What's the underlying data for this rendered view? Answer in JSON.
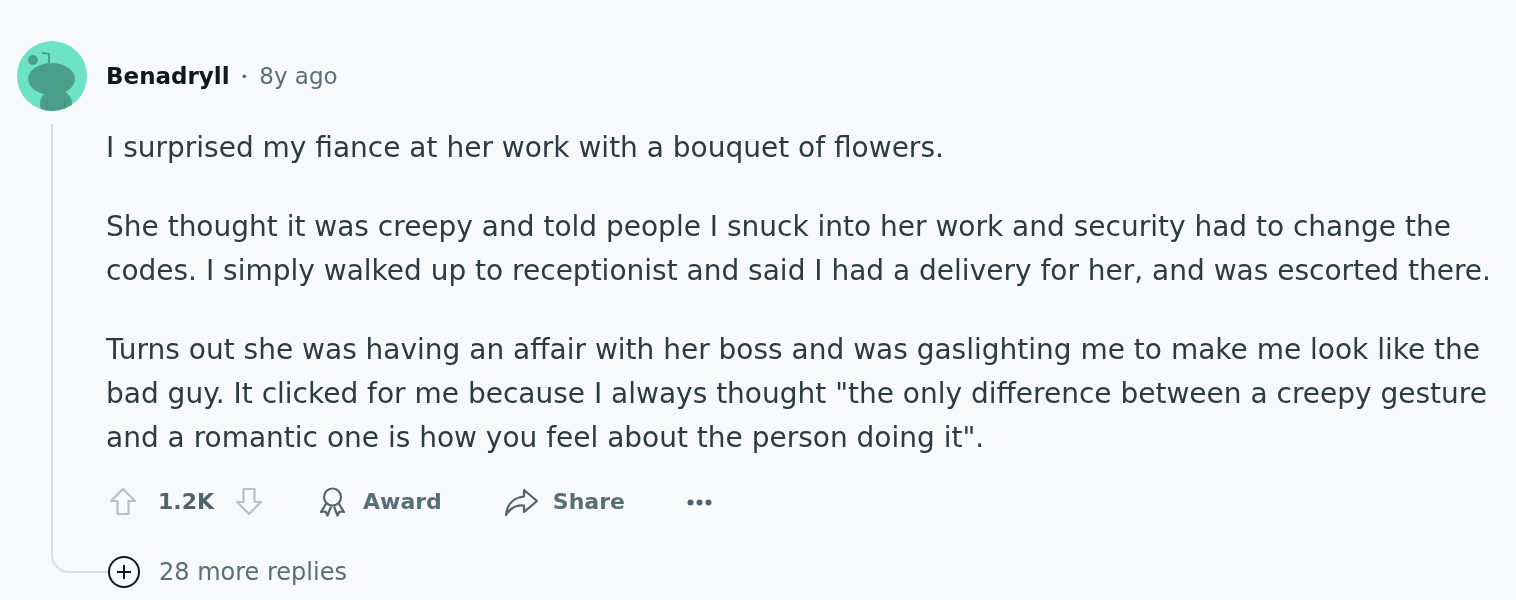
{
  "comment": {
    "author": "Benadryll",
    "separator": "•",
    "age": "8y ago",
    "paragraphs": [
      "I surprised my fiance at her work with a bouquet of flowers.",
      "She thought it was creepy and told people I snuck into her work and security had to change the codes. I simply walked up to receptionist and said I had a delivery for her, and was escorted there.",
      "Turns out she was having an affair with her boss and was gaslighting me to make me look like the bad guy. It clicked for me because I always thought \"the only difference between a creepy gesture and a romantic one is how you feel about the person doing it\"."
    ],
    "upvoted": false,
    "downvoted": false,
    "score": "1.2K",
    "actions": [
      {
        "kind": "award",
        "label": "Award"
      },
      {
        "kind": "share",
        "label": "Share"
      },
      {
        "kind": "more"
      }
    ]
  },
  "more_replies": {
    "label": "28 more replies"
  }
}
